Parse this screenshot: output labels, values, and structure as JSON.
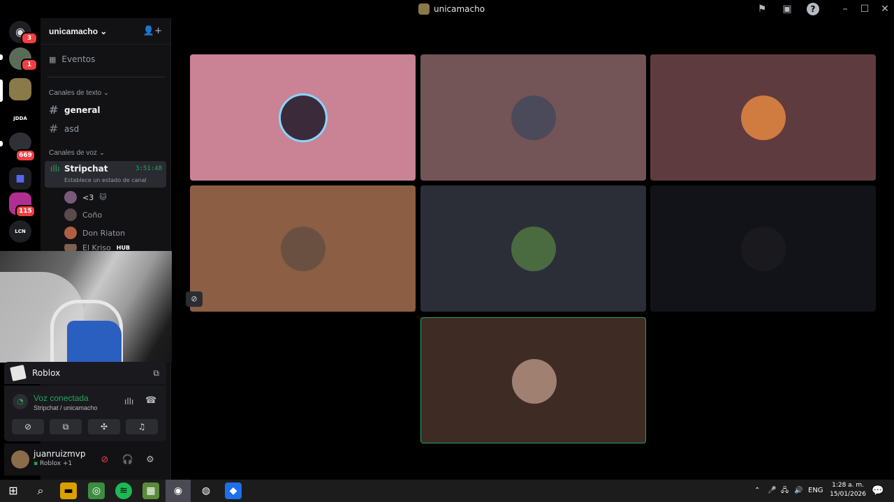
{
  "window": {
    "title": "unicamacho"
  },
  "rail": {
    "badges": [
      "3",
      "1",
      "669",
      "115"
    ],
    "label_jdda": "JDDA",
    "label_lcn": "LCN"
  },
  "sidebar": {
    "server_name": "unicamacho",
    "events_label": "Eventos",
    "text_category": "Canales de texto",
    "text_channels": [
      "general",
      "asd"
    ],
    "voice_category": "Canales de voz",
    "voice_channel": {
      "name": "Stripchat",
      "timer": "3:51:48",
      "status": "Establece un estado de canal"
    },
    "voice_users": [
      "<3",
      "Coño",
      "Don Riaton",
      "El Kriso"
    ],
    "voice_user_tag": "HUB"
  },
  "activity": {
    "game": "Roblox"
  },
  "voice_panel": {
    "status": "Voz conectada",
    "location": "Stripchat / unicamacho"
  },
  "user_panel": {
    "username": "juanruizmvp",
    "activity": "Roblox +1"
  },
  "taskbar": {
    "language": "ENG",
    "time": "1:28 a. m.",
    "date": "15/01/2026"
  },
  "colors": {
    "accent_green": "#23a55a",
    "tile_pink": "#c98395",
    "tile_mauve": "#735557",
    "tile_plum": "#5e3b3f",
    "tile_tan": "#8c5e44",
    "tile_slate": "#2b2e37",
    "tile_dark": "#121318",
    "tile_brown": "#3d2b24"
  }
}
